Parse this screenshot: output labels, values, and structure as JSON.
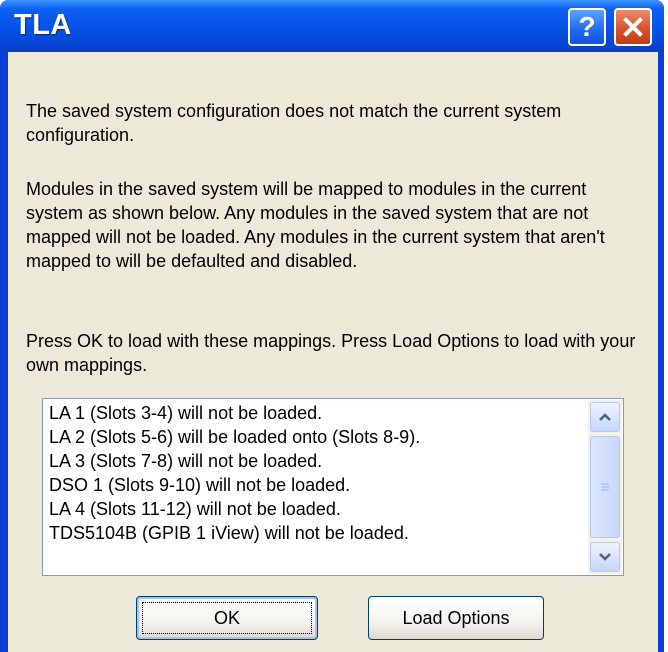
{
  "window": {
    "title": "TLA"
  },
  "titlebar_buttons": {
    "help_glyph": "?"
  },
  "message": {
    "p1": "The saved system configuration does not match the current system configuration.",
    "p2": "Modules in the saved system will be mapped to modules in the current system as shown below. Any modules in the saved system that are not mapped will not be loaded. Any modules in the current system that aren't mapped to will be defaulted and disabled.",
    "p3": "Press OK to load with these mappings. Press Load Options to load with your own mappings."
  },
  "mappings": [
    "LA 1 (Slots 3-4) will not be loaded.",
    "LA 2 (Slots 5-6) will be loaded onto  (Slots 8-9).",
    "LA 3 (Slots 7-8) will not be loaded.",
    "DSO 1 (Slots 9-10) will not be loaded.",
    "LA 4 (Slots 11-12) will not be loaded.",
    "TDS5104B (GPIB 1 iView) will not be loaded."
  ],
  "buttons": {
    "ok_label": "OK",
    "load_options_label": "Load Options"
  },
  "colors": {
    "titlebar": "#0553e6",
    "dialog_bg": "#ece9d8",
    "close_button": "#d8532d"
  },
  "icons": {
    "help": "help-icon",
    "close": "close-icon",
    "scroll_up": "chevron-up-icon",
    "scroll_down": "chevron-down-icon",
    "thumb_grip": "grip-icon"
  }
}
